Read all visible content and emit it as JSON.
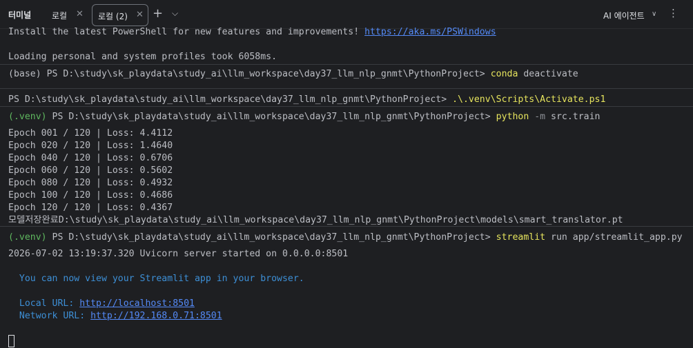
{
  "tabbar": {
    "title": "터미널",
    "tabs": [
      {
        "label": "로컬"
      },
      {
        "label": "로컬 (2)"
      }
    ],
    "close_glyph": "✕",
    "new_tab_glyph": "+",
    "dropdown_glyph": "⌵",
    "ai_agent_label": "AI 에이전트",
    "ai_agent_chevron": "∨",
    "more_glyph": "⋮"
  },
  "terminal": {
    "install_text": "Install the latest PowerShell for new features and improvements! ",
    "install_link": "https://aka.ms/PSWindows",
    "loading": "Loading personal and system profiles took 6058ms.",
    "base_prompt": "(base) PS D:\\study\\sk_playdata\\study_ai\\llm_workspace\\day37_llm_nlp_gnmt\\PythonProject> ",
    "cmd1_name": "conda",
    "cmd1_args": " deactivate",
    "ps_prompt": "PS D:\\study\\sk_playdata\\study_ai\\llm_workspace\\day37_llm_nlp_gnmt\\PythonProject> ",
    "cmd2": ".\\.venv\\Scripts\\Activate.ps1",
    "venv_label": "(.venv)",
    "venv_prompt_path": " PS D:\\study\\sk_playdata\\study_ai\\llm_workspace\\day37_llm_nlp_gnmt\\PythonProject> ",
    "cmd3_name": "python",
    "cmd3_flag": " -m",
    "cmd3_args": " src.train",
    "epochs": [
      "Epoch 001 / 120 | Loss: 4.4112",
      "Epoch 020 / 120 | Loss: 1.4640",
      "Epoch 040 / 120 | Loss: 0.6706",
      "Epoch 060 / 120 | Loss: 0.5602",
      "Epoch 080 / 120 | Loss: 0.4932",
      "Epoch 100 / 120 | Loss: 0.4686",
      "Epoch 120 / 120 | Loss: 0.4367"
    ],
    "saved": "모델저장완료D:\\study\\sk_playdata\\study_ai\\llm_workspace\\day37_llm_nlp_gnmt\\PythonProject\\models\\smart_translator.pt",
    "cmd4_name": "streamlit",
    "cmd4_args": " run app/streamlit_app.py",
    "uvicorn": "2026-07-02 13:19:37.320 Uvicorn server started on 0.0.0.0:8501",
    "view_msg": "  You can now view your Streamlit app in your browser.",
    "local_label": "  Local URL: ",
    "local_url": "http://localhost:8501",
    "network_label": "  Network URL: ",
    "network_url": "http://192.168.0.71:8501"
  }
}
